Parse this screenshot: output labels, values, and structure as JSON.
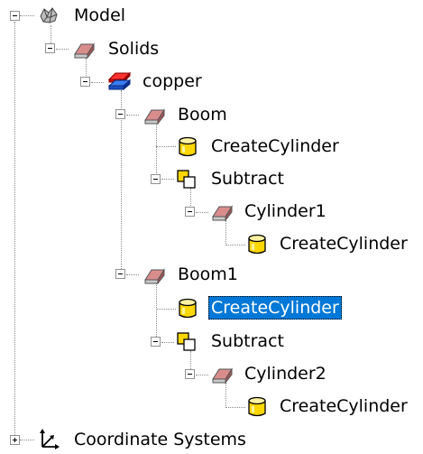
{
  "tree": {
    "model": {
      "label": "Model",
      "icon": "model-icon"
    },
    "solids": {
      "label": "Solids",
      "icon": "solid-group-icon"
    },
    "copper": {
      "label": "copper",
      "icon": "material-icon"
    },
    "boom": {
      "label": "Boom",
      "icon": "solid-body-icon"
    },
    "boom_create": {
      "label": "CreateCylinder",
      "icon": "cylinder-icon"
    },
    "boom_subtract": {
      "label": "Subtract",
      "icon": "subtract-icon"
    },
    "cylinder1": {
      "label": "Cylinder1",
      "icon": "solid-body-icon"
    },
    "cylinder1_create": {
      "label": "CreateCylinder",
      "icon": "cylinder-icon"
    },
    "boom1": {
      "label": "Boom1",
      "icon": "solid-body-icon"
    },
    "boom1_create": {
      "label": "CreateCylinder",
      "icon": "cylinder-icon",
      "selected": true
    },
    "boom1_subtract": {
      "label": "Subtract",
      "icon": "subtract-icon"
    },
    "cylinder2": {
      "label": "Cylinder2",
      "icon": "solid-body-icon"
    },
    "cylinder2_create": {
      "label": "CreateCylinder",
      "icon": "cylinder-icon"
    },
    "coordinate_systems": {
      "label": "Coordinate Systems",
      "icon": "coordinate-axes-icon"
    }
  },
  "colors": {
    "selection": "#0078d7",
    "cylinder_fill": "#ffd700",
    "solid_fill": "#cc7777",
    "copper_red": "#e02020",
    "copper_blue": "#2060e0"
  }
}
